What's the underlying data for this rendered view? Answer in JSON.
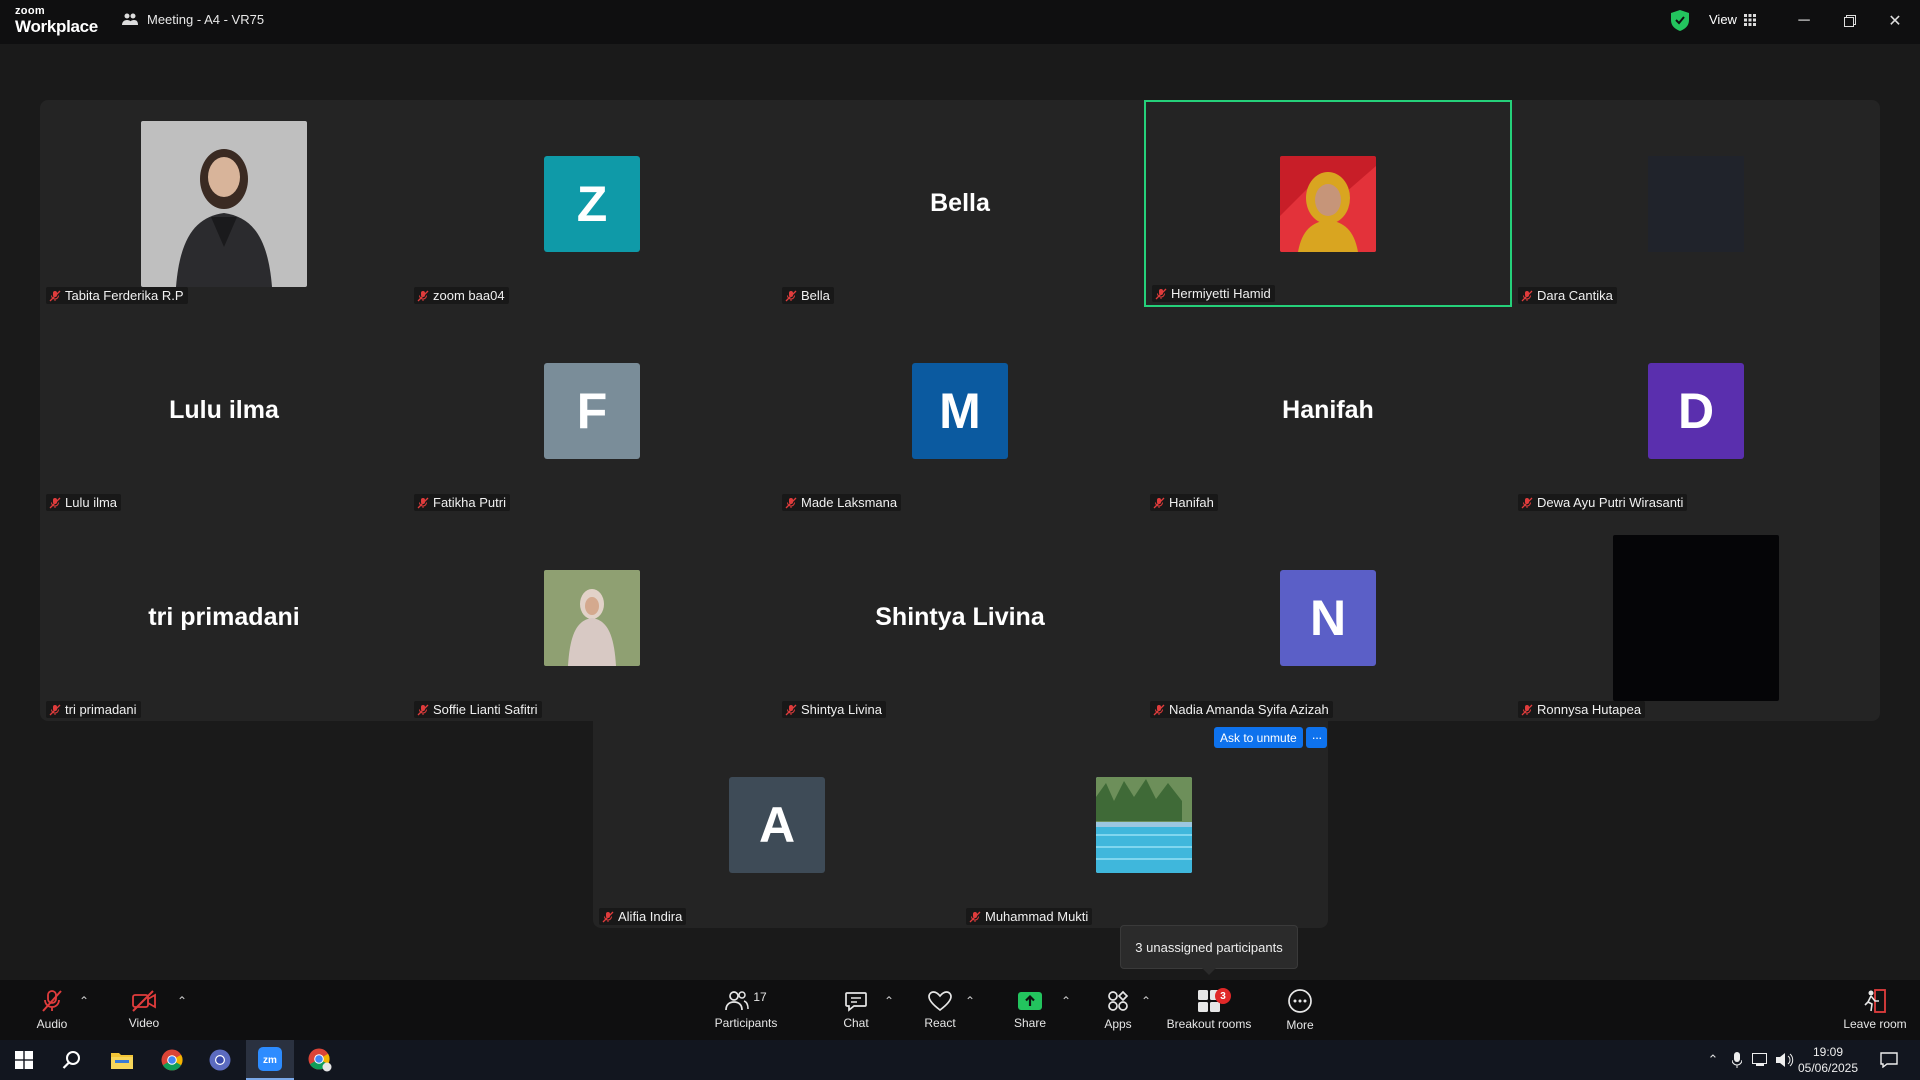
{
  "titlebar": {
    "logo_top": "zoom",
    "logo_bottom": "Workplace",
    "meeting_title": "Meeting - A4 - VR75",
    "view_label": "View"
  },
  "tiles": [
    {
      "name": "Tabita Ferderika R.P",
      "display": "photo"
    },
    {
      "name": "zoom baa04",
      "display": "avatar",
      "initial": "Z",
      "color": "#0f9aa8"
    },
    {
      "name": "Bella",
      "display": "name",
      "big": "Bella"
    },
    {
      "name": "Hermiyetti Hamid",
      "display": "photo"
    },
    {
      "name": "Dara Cantika",
      "display": "blank"
    },
    {
      "name": "Lulu ilma",
      "display": "name",
      "big": "Lulu ilma"
    },
    {
      "name": "Fatikha Putri",
      "display": "avatar",
      "initial": "F",
      "color": "#7a8d99"
    },
    {
      "name": "Made Laksmana",
      "display": "avatar",
      "initial": "M",
      "color": "#0b5aa0"
    },
    {
      "name": "Hanifah",
      "display": "name",
      "big": "Hanifah"
    },
    {
      "name": "Dewa Ayu Putri Wirasanti",
      "display": "avatar",
      "initial": "D",
      "color": "#5a2fae"
    },
    {
      "name": "tri primadani",
      "display": "name",
      "big": "tri primadani"
    },
    {
      "name": "Soffie Lianti Safitri",
      "display": "photo"
    },
    {
      "name": "Shintya Livina",
      "display": "name",
      "big": "Shintya Livina"
    },
    {
      "name": "Nadia Amanda Syifa Azizah",
      "display": "avatar",
      "initial": "N",
      "color": "#5b5fc7"
    },
    {
      "name": "Ronnysa Hutapea",
      "display": "black"
    },
    {
      "name": "Alifia Indira",
      "display": "avatar",
      "initial": "A",
      "color": "#3e4b57"
    },
    {
      "name": "Muhammad Mukti",
      "display": "photo"
    }
  ],
  "ask_unmute": "Ask to unmute",
  "ask_more": "···",
  "tooltip": "3 unassigned participants",
  "toolbar": {
    "audio": "Audio",
    "video": "Video",
    "participants": "Participants",
    "participants_count": "17",
    "chat": "Chat",
    "react": "React",
    "share": "Share",
    "apps": "Apps",
    "breakout": "Breakout rooms",
    "breakout_badge": "3",
    "more": "More",
    "leave": "Leave room"
  },
  "taskbar": {
    "time": "19:09",
    "date": "05/06/2025"
  },
  "colors": {
    "active_speaker": "#25d07a",
    "share_green": "#23c45e",
    "accent_blue": "#0e72ed"
  }
}
